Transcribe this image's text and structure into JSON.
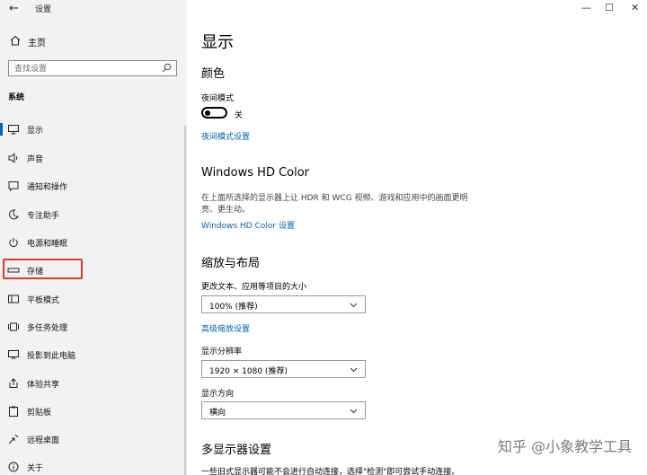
{
  "window": {
    "title": "设置",
    "minimize": "—",
    "maximize": "☐",
    "close": "✕"
  },
  "sidebar": {
    "home": "主页",
    "search_placeholder": "查找设置",
    "section": "系统",
    "items": [
      {
        "label": "显示",
        "icon": "monitor-icon"
      },
      {
        "label": "声音",
        "icon": "speaker-icon"
      },
      {
        "label": "通知和操作",
        "icon": "notification-icon"
      },
      {
        "label": "专注助手",
        "icon": "moon-icon"
      },
      {
        "label": "电源和睡眠",
        "icon": "power-icon"
      },
      {
        "label": "存储",
        "icon": "storage-icon"
      },
      {
        "label": "平板模式",
        "icon": "tablet-icon"
      },
      {
        "label": "多任务处理",
        "icon": "multitask-icon"
      },
      {
        "label": "投影到此电脑",
        "icon": "project-icon"
      },
      {
        "label": "体验共享",
        "icon": "share-icon"
      },
      {
        "label": "剪贴板",
        "icon": "clipboard-icon"
      },
      {
        "label": "远程桌面",
        "icon": "remote-icon"
      },
      {
        "label": "关于",
        "icon": "info-icon"
      }
    ]
  },
  "main": {
    "title": "显示",
    "color": {
      "heading": "颜色",
      "night_light_label": "夜间模式",
      "toggle_state": "关",
      "night_light_link": "夜间模式设置"
    },
    "hdr": {
      "heading": "Windows HD Color",
      "description": "在上面所选择的显示器上让 HDR 和 WCG 视频、游戏和应用中的画面更明亮、更生动。",
      "link": "Windows HD Color 设置"
    },
    "layout": {
      "heading": "缩放与布局",
      "scale_label": "更改文本、应用等项目的大小",
      "scale_value": "100% (推荐)",
      "advanced_link": "高级缩放设置",
      "resolution_label": "显示分辨率",
      "resolution_value": "1920 × 1080 (推荐)",
      "orientation_label": "显示方向",
      "orientation_value": "横向"
    },
    "multi": {
      "heading": "多显示器设置",
      "footer": "一些旧式显示器可能不会进行自动连接，选择\"检测\"即可尝试手动连接。"
    }
  },
  "watermark": "知乎 @小象教学工具"
}
